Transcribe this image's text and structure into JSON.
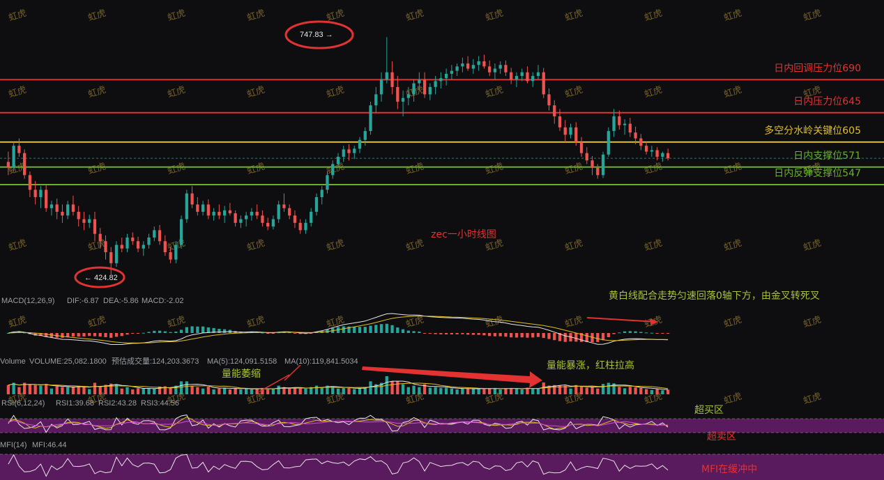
{
  "chart_data": {
    "type": "candlestick",
    "title": "zec一小时线图",
    "price_range": [
      400,
      770
    ],
    "high_marker": "747.83 →",
    "low_marker": "← 424.82",
    "current_price": 583,
    "candles": [
      [
        578,
        592,
        560,
        570
      ],
      [
        570,
        605,
        565,
        600
      ],
      [
        600,
        610,
        585,
        590
      ],
      [
        590,
        595,
        555,
        560
      ],
      [
        560,
        565,
        530,
        540
      ],
      [
        540,
        552,
        520,
        530
      ],
      [
        530,
        545,
        515,
        540
      ],
      [
        540,
        546,
        510,
        515
      ],
      [
        515,
        525,
        505,
        520
      ],
      [
        520,
        528,
        500,
        510
      ],
      [
        510,
        520,
        495,
        505
      ],
      [
        505,
        525,
        500,
        520
      ],
      [
        520,
        532,
        505,
        510
      ],
      [
        510,
        518,
        490,
        500
      ],
      [
        500,
        510,
        485,
        495
      ],
      [
        495,
        506,
        488,
        500
      ],
      [
        500,
        510,
        470,
        480
      ],
      [
        480,
        488,
        460,
        470
      ],
      [
        470,
        478,
        445,
        455
      ],
      [
        455,
        462,
        424.82,
        440
      ],
      [
        440,
        470,
        435,
        465
      ],
      [
        465,
        475,
        455,
        460
      ],
      [
        460,
        480,
        455,
        475
      ],
      [
        475,
        482,
        465,
        470
      ],
      [
        470,
        476,
        455,
        460
      ],
      [
        460,
        470,
        450,
        465
      ],
      [
        465,
        480,
        460,
        475
      ],
      [
        475,
        490,
        470,
        485
      ],
      [
        485,
        492,
        465,
        470
      ],
      [
        470,
        478,
        450,
        455
      ],
      [
        455,
        462,
        440,
        445
      ],
      [
        445,
        470,
        440,
        465
      ],
      [
        465,
        505,
        460,
        500
      ],
      [
        500,
        540,
        495,
        535
      ],
      [
        535,
        545,
        515,
        520
      ],
      [
        520,
        530,
        505,
        510
      ],
      [
        510,
        525,
        505,
        520
      ],
      [
        520,
        527,
        500,
        505
      ],
      [
        505,
        515,
        498,
        510
      ],
      [
        510,
        520,
        500,
        505
      ],
      [
        505,
        518,
        495,
        512
      ],
      [
        512,
        522,
        505,
        508
      ],
      [
        508,
        512,
        490,
        495
      ],
      [
        495,
        505,
        488,
        500
      ],
      [
        500,
        510,
        490,
        505
      ],
      [
        505,
        515,
        498,
        510
      ],
      [
        510,
        520,
        500,
        505
      ],
      [
        505,
        512,
        490,
        495
      ],
      [
        495,
        502,
        485,
        490
      ],
      [
        490,
        505,
        486,
        500
      ],
      [
        500,
        525,
        495,
        520
      ],
      [
        520,
        535,
        510,
        515
      ],
      [
        515,
        520,
        500,
        505
      ],
      [
        505,
        512,
        488,
        495
      ],
      [
        495,
        500,
        480,
        485
      ],
      [
        485,
        500,
        480,
        495
      ],
      [
        495,
        515,
        490,
        510
      ],
      [
        510,
        535,
        505,
        530
      ],
      [
        530,
        545,
        520,
        540
      ],
      [
        540,
        565,
        535,
        560
      ],
      [
        560,
        580,
        555,
        575
      ],
      [
        575,
        590,
        570,
        585
      ],
      [
        585,
        600,
        578,
        595
      ],
      [
        595,
        602,
        580,
        590
      ],
      [
        590,
        600,
        582,
        596
      ],
      [
        596,
        612,
        590,
        608
      ],
      [
        608,
        625,
        600,
        620
      ],
      [
        620,
        660,
        615,
        655
      ],
      [
        655,
        680,
        645,
        670
      ],
      [
        670,
        700,
        660,
        690
      ],
      [
        690,
        747.83,
        685,
        700
      ],
      [
        700,
        715,
        670,
        680
      ],
      [
        680,
        695,
        650,
        660
      ],
      [
        660,
        675,
        640,
        665
      ],
      [
        665,
        680,
        655,
        670
      ],
      [
        670,
        690,
        660,
        685
      ],
      [
        685,
        700,
        675,
        690
      ],
      [
        690,
        700,
        665,
        670
      ],
      [
        670,
        685,
        662,
        680
      ],
      [
        680,
        695,
        670,
        688
      ],
      [
        688,
        700,
        678,
        692
      ],
      [
        692,
        705,
        682,
        698
      ],
      [
        698,
        710,
        690,
        702
      ],
      [
        702,
        712,
        695,
        708
      ],
      [
        708,
        720,
        700,
        712
      ],
      [
        712,
        722,
        702,
        705
      ],
      [
        705,
        718,
        698,
        710
      ],
      [
        710,
        722,
        702,
        715
      ],
      [
        715,
        724,
        705,
        708
      ],
      [
        708,
        716,
        695,
        700
      ],
      [
        700,
        712,
        690,
        705
      ],
      [
        705,
        715,
        698,
        710
      ],
      [
        710,
        716,
        695,
        700
      ],
      [
        700,
        706,
        684,
        690
      ],
      [
        690,
        700,
        680,
        695
      ],
      [
        695,
        705,
        688,
        700
      ],
      [
        700,
        708,
        685,
        688
      ],
      [
        688,
        700,
        680,
        695
      ],
      [
        695,
        710,
        690,
        700
      ],
      [
        700,
        706,
        665,
        670
      ],
      [
        670,
        678,
        648,
        655
      ],
      [
        655,
        662,
        630,
        640
      ],
      [
        640,
        650,
        620,
        625
      ],
      [
        625,
        635,
        605,
        615
      ],
      [
        615,
        630,
        610,
        625
      ],
      [
        625,
        632,
        600,
        605
      ],
      [
        605,
        612,
        585,
        590
      ],
      [
        590,
        598,
        575,
        580
      ],
      [
        580,
        586,
        560,
        570
      ],
      [
        570,
        575,
        555,
        560
      ],
      [
        560,
        592,
        556,
        588
      ],
      [
        588,
        625,
        585,
        620
      ],
      [
        620,
        650,
        612,
        640
      ],
      [
        640,
        648,
        622,
        628
      ],
      [
        628,
        636,
        615,
        630
      ],
      [
        630,
        638,
        612,
        618
      ],
      [
        618,
        626,
        602,
        610
      ],
      [
        610,
        616,
        594,
        600
      ],
      [
        600,
        606,
        588,
        592
      ],
      [
        592,
        600,
        585,
        594
      ],
      [
        594,
        598,
        580,
        585
      ],
      [
        585,
        592,
        578,
        590
      ],
      [
        590,
        596,
        580,
        583
      ]
    ],
    "levels": [
      {
        "label": "日内回调压力位690",
        "value": 690,
        "color": "#e23232"
      },
      {
        "label": "日内压力位645",
        "value": 645,
        "color": "#e23232"
      },
      {
        "label": "多空分水岭关键位605",
        "value": 605,
        "color": "#e0c020"
      },
      {
        "label": "日内支撑位571",
        "value": 571,
        "color": "#6ab02a"
      },
      {
        "label": "日内反弹支撑位547",
        "value": 547,
        "color": "#6ab02a"
      }
    ]
  },
  "indicators": {
    "macd": {
      "name": "MACD(12,26,9)",
      "dif": "DIF:-6.87",
      "dea": "DEA:-5.86",
      "macd": "MACD:-2.02"
    },
    "volume": {
      "name": "Volume",
      "volume": "VOLUME:25,082.1800",
      "est": "预估成交量:124,203.3673",
      "ma5": "MA(5):124,091.5158",
      "ma10": "MA(10):119,841.5034"
    },
    "rsi": {
      "name": "RSI(6,12,24)",
      "rsi1": "RSI1:39.68",
      "rsi2": "RSI2:43.28",
      "rsi3": "RSI3:44.56"
    },
    "mfi": {
      "name": "MFI(14)",
      "mfi": "MFI:46.44"
    }
  },
  "annotations": {
    "macd_note": "黄白线配合走势匀速回落0轴下方，由金叉转死叉",
    "vol_shrink": "量能萎缩",
    "vol_surge": "量能暴涨，红柱拉高",
    "overbought": "超买区",
    "oversold": "超卖区",
    "mfi_note": "MFI在缓冲中"
  },
  "watermark": "虹虎",
  "colors": {
    "up": "#26a69a",
    "down": "#ef5350",
    "ma_yellow": "#e0c020",
    "white_line": "#e8e8e8",
    "purple": "#5a1a5e"
  }
}
